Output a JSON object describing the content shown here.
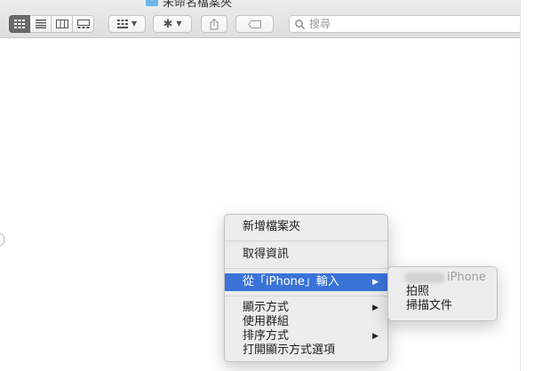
{
  "window": {
    "title": "未命名檔案夾"
  },
  "toolbar": {
    "search_placeholder": "搜尋",
    "view_modes": [
      "icon-view",
      "list-view",
      "column-view",
      "gallery-view"
    ],
    "active_view": "icon-view"
  },
  "context_menu": {
    "items": [
      {
        "label": "新增檔案夾"
      },
      {
        "label": "取得資訊"
      },
      {
        "label": "從「iPhone」輸入",
        "has_submenu": true,
        "highlighted": true
      },
      {
        "label": "顯示方式",
        "has_submenu": true
      },
      {
        "label": "使用群組"
      },
      {
        "label": "排序方式",
        "has_submenu": true
      },
      {
        "label": "打開顯示方式選項"
      }
    ]
  },
  "submenu": {
    "device_label": "iPhone",
    "items": [
      {
        "label": "拍照"
      },
      {
        "label": "掃描文件"
      }
    ]
  },
  "colors": {
    "highlight": "#3a73d8",
    "folder": "#6db6ec",
    "menu_bg": "#ececec"
  }
}
